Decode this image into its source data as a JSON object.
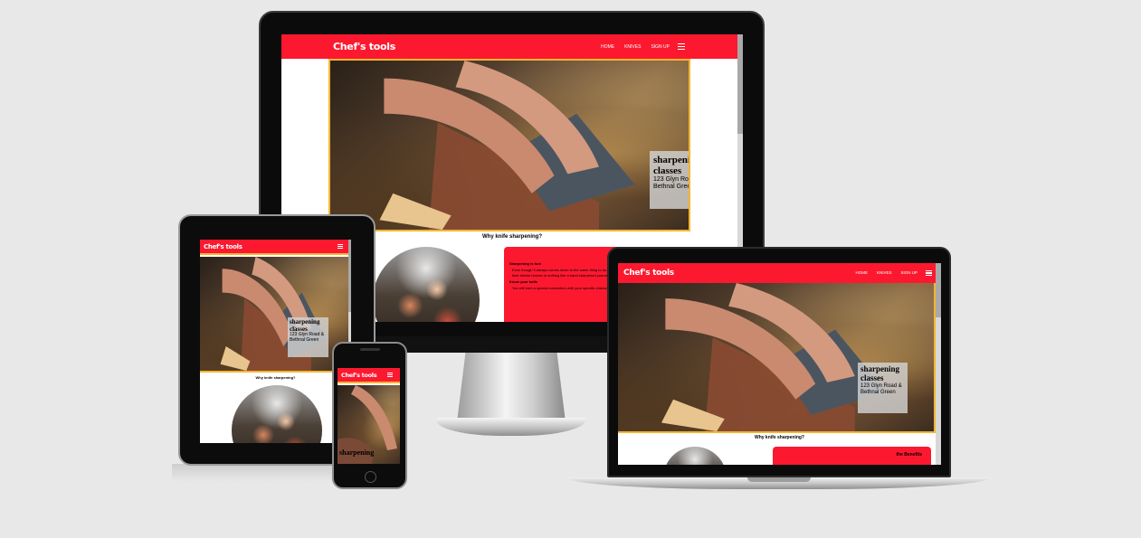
{
  "site": {
    "brand": "Chef's tools",
    "nav": [
      "HOME",
      "KNIVES",
      "SIGN UP"
    ],
    "hero_title": "sharpening classes",
    "hero_address": "123 Glyn Road & Bethnal Green",
    "section_title": "Why knife sharpening?",
    "card_heading_1": "Sharpening is fun!",
    "card_text_1": "Even though it always comes down to the same thing to do. While some love to cook, shop, sharpening their kitchen knives is nothing like a hand sharpened yourself.",
    "card_heading_2": "Know your knife",
    "card_text_2": "You will form a special connection with your specific character, the shape of its edge and the",
    "laptop_card_heading": "the Benefits",
    "phone_title_fragment": "sharpening"
  },
  "colors": {
    "brand_red": "#fc1930",
    "hero_border": "#f2b632",
    "page_bg": "#e8e8e8"
  },
  "icons": {
    "menu": "hamburger-icon"
  }
}
